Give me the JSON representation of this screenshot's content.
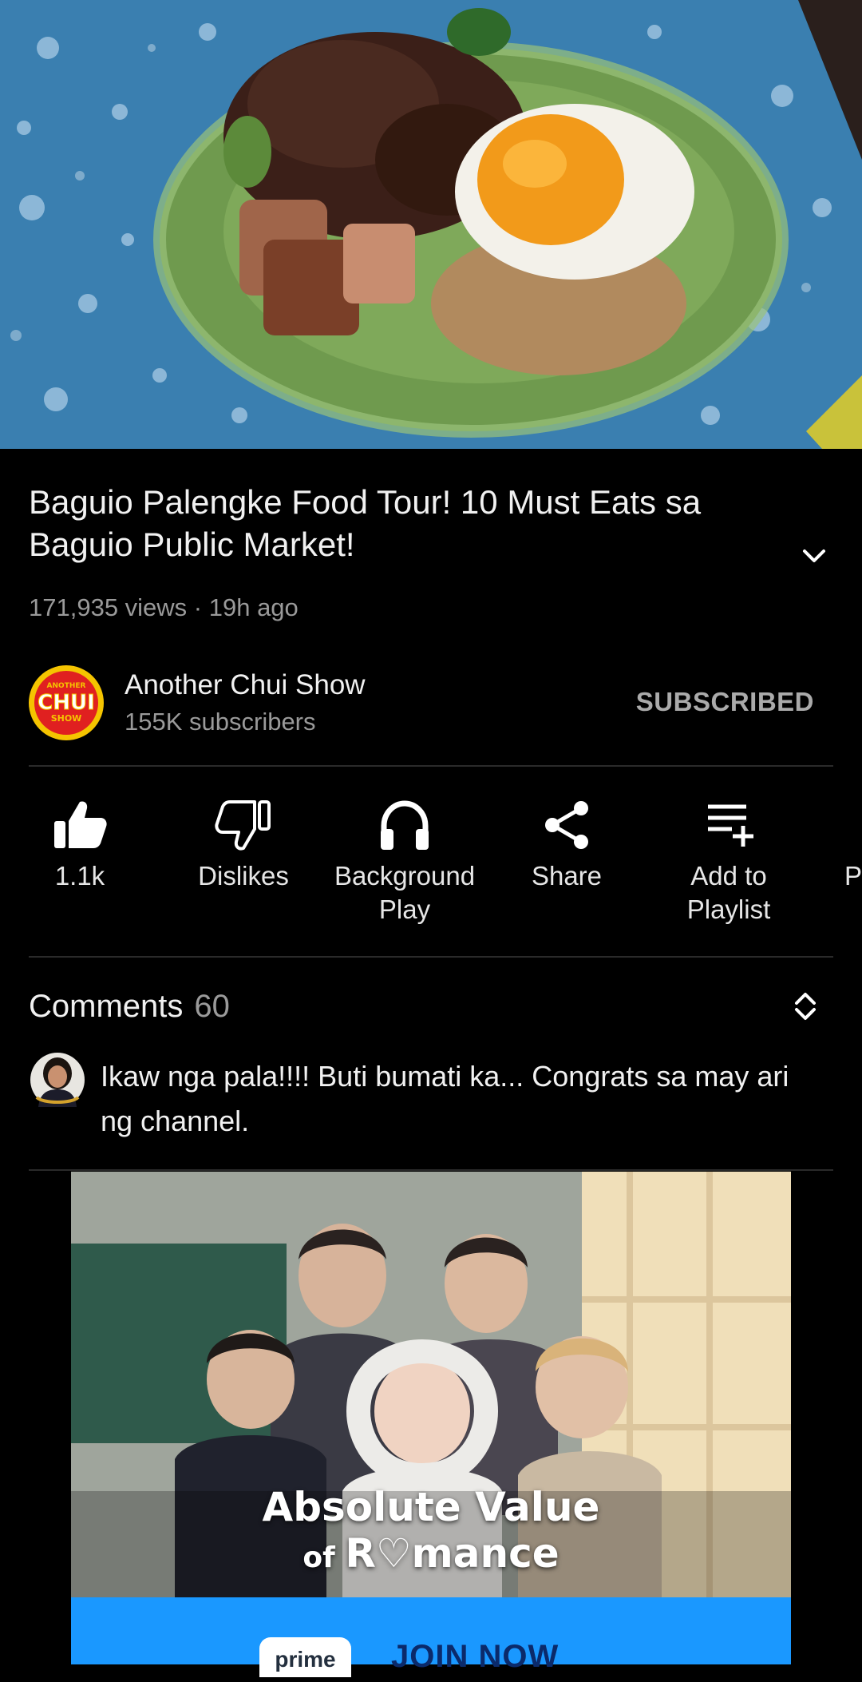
{
  "video": {
    "thumbnail_subject": "plate-of-food-thumbnail"
  },
  "title": "Baguio Palengke Food Tour! 10 Must Eats sa Baguio Public Market!",
  "meta": "171,935 views · 19h ago",
  "channel": {
    "name": "Another Chui Show",
    "subscribers": "155K subscribers",
    "logo_top": "ANOTHER",
    "logo_main": "CHUI",
    "logo_bottom": "SHOW",
    "subscribe_state": "SUBSCRIBED"
  },
  "actions": [
    {
      "label": "1.1k",
      "icon": "thumbs-up-icon"
    },
    {
      "label": "Dislikes",
      "icon": "thumbs-down-icon"
    },
    {
      "label": "Background Play",
      "icon": "headphones-icon"
    },
    {
      "label": "Share",
      "icon": "share-icon"
    },
    {
      "label": "Add to Playlist",
      "icon": "playlist-add-icon"
    },
    {
      "label": "P",
      "icon": ""
    }
  ],
  "comments": {
    "label": "Comments",
    "count": "60",
    "top_comment": "Ikaw nga pala!!!! Buti bumati ka... Congrats sa may ari ng channel."
  },
  "ad": {
    "title_line1": "Absolute Value",
    "title_line2_prefix": "of ",
    "title_line2": "R♡mance",
    "badge": "prime",
    "cta": "JOIN NOW"
  },
  "colors": {
    "background": "#000000",
    "subscribed": "#aaaaaa",
    "logo_yellow": "#f5c400",
    "logo_red": "#e02020",
    "ad_banner": "#1a98ff"
  }
}
